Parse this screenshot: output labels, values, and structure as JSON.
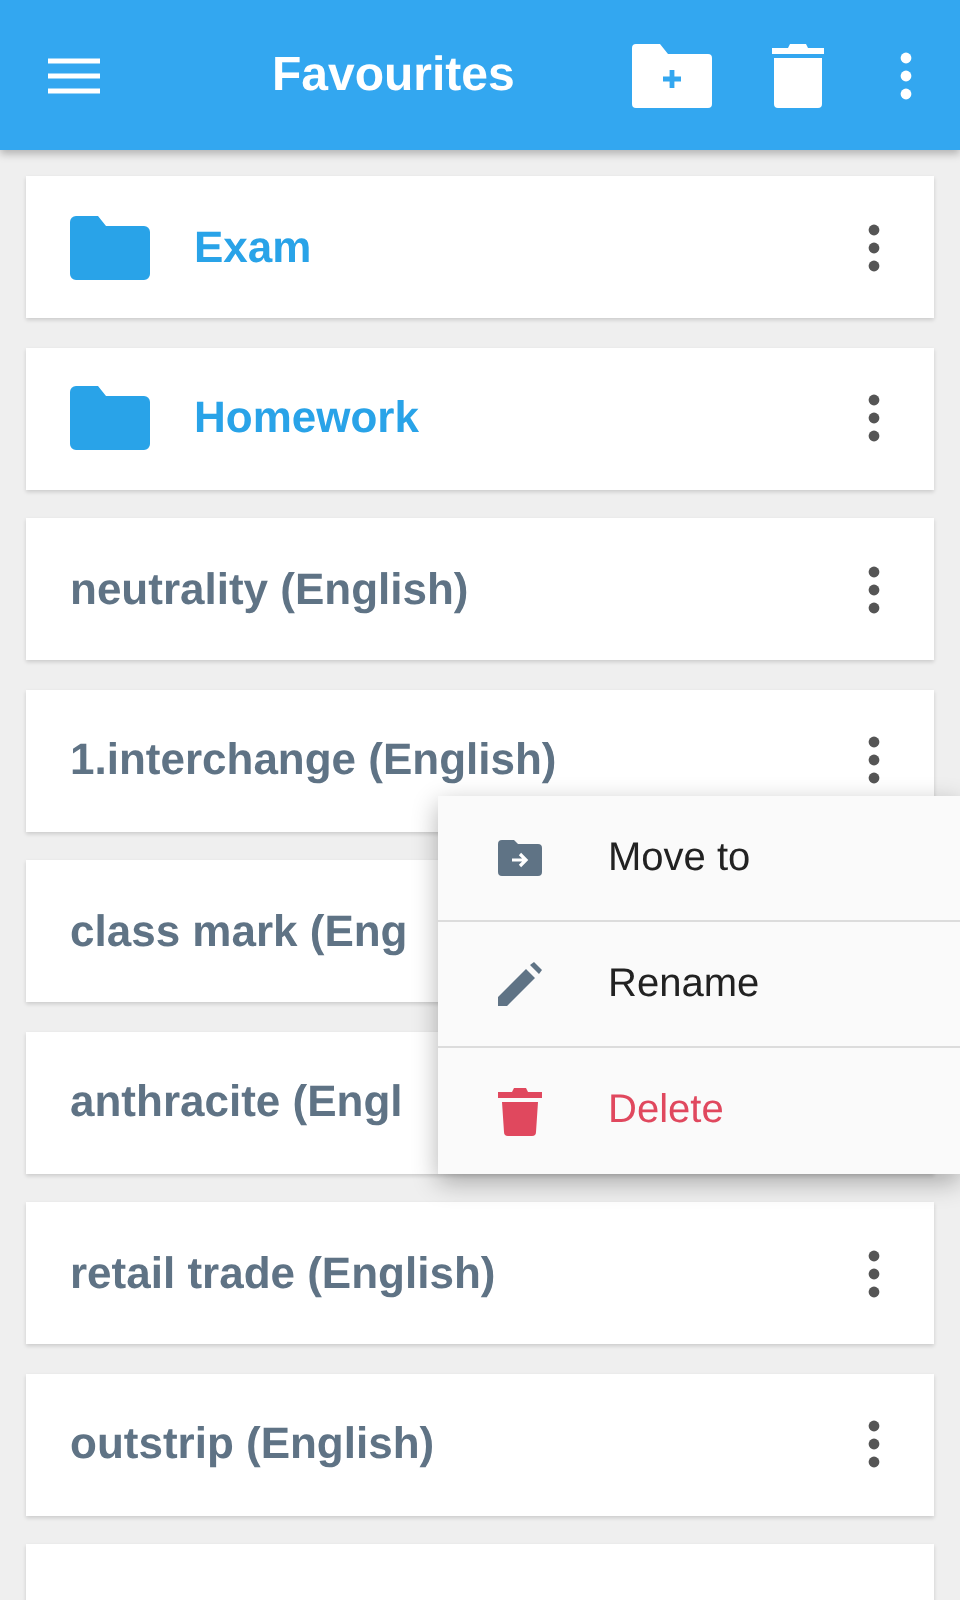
{
  "app_bar": {
    "title": "Favourites"
  },
  "items": [
    {
      "kind": "folder",
      "label": "Exam"
    },
    {
      "kind": "folder",
      "label": "Homework"
    },
    {
      "kind": "word",
      "label": "neutrality (English)"
    },
    {
      "kind": "word",
      "label": "1.interchange (English)"
    },
    {
      "kind": "covered",
      "label": "class mark (Eng"
    },
    {
      "kind": "covered",
      "label": "anthracite (Engl"
    },
    {
      "kind": "word",
      "label": "retail trade (English)"
    },
    {
      "kind": "word",
      "label": "outstrip (English)"
    },
    {
      "kind": "blank"
    }
  ],
  "context_menu": [
    {
      "kind": "move",
      "label": "Move to"
    },
    {
      "kind": "rename",
      "label": "Rename"
    },
    {
      "kind": "delete",
      "label": "Delete"
    }
  ]
}
